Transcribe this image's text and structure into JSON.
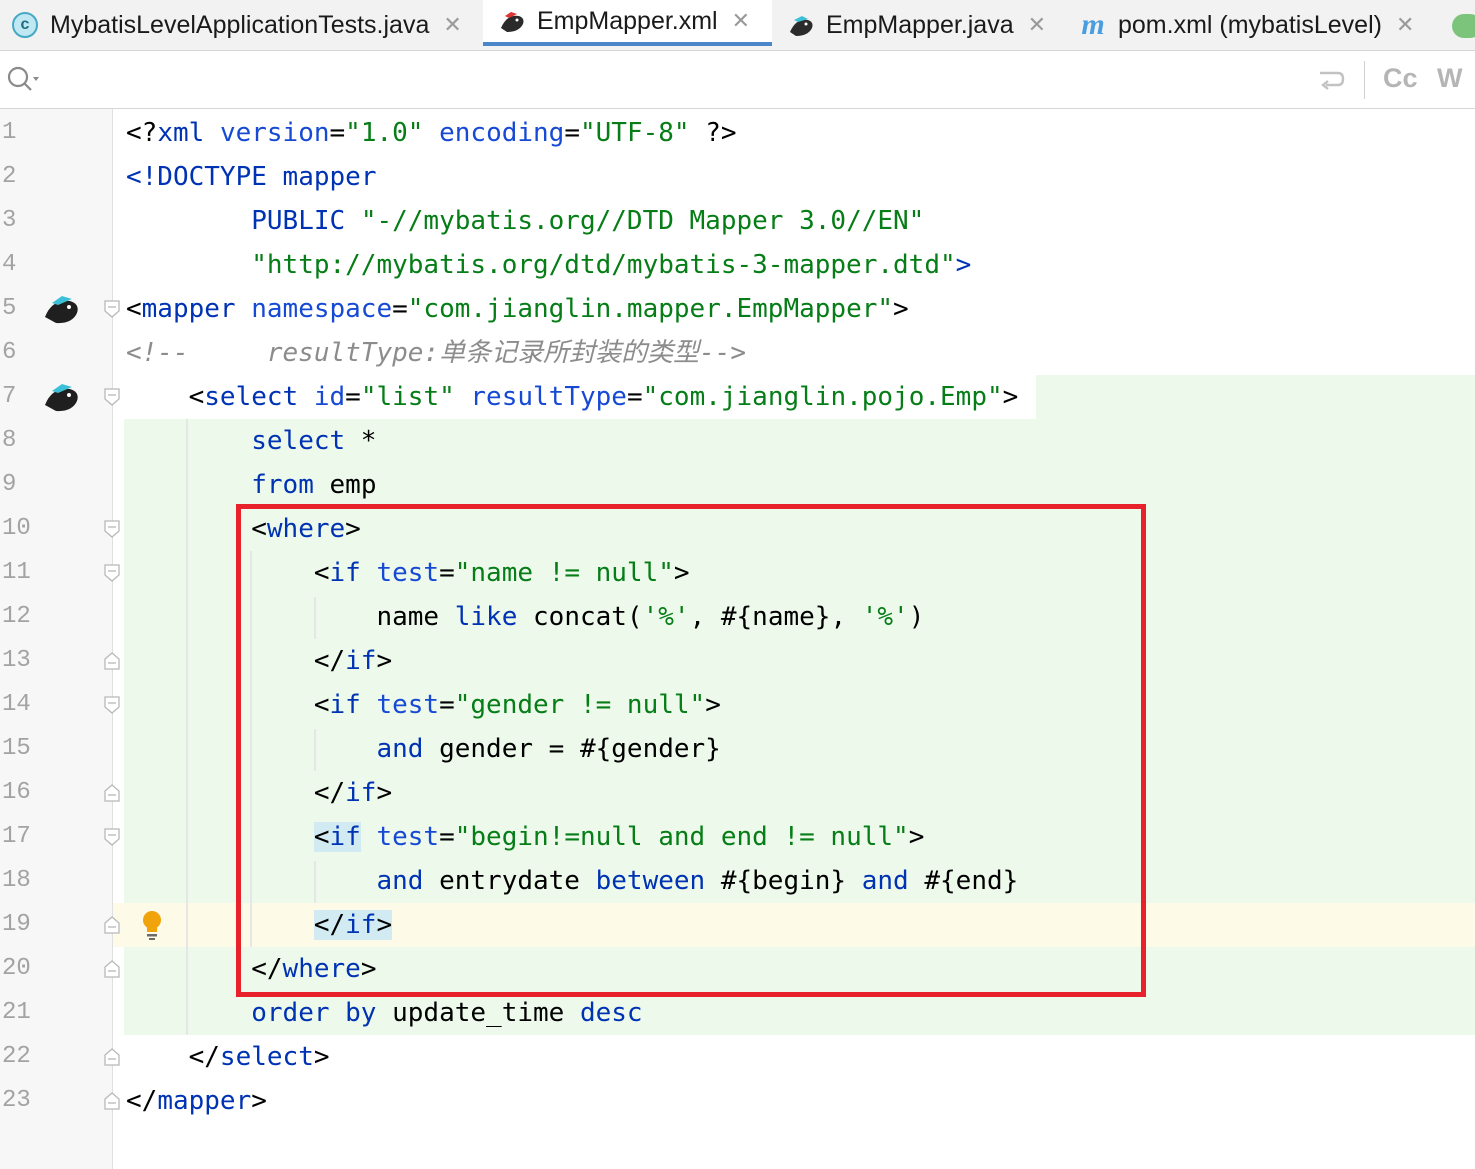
{
  "tabs": [
    {
      "label": "MybatisLevelApplicationTests.java",
      "icon": "java-class-icon",
      "active": false
    },
    {
      "label": "EmpMapper.xml",
      "icon": "mybatis-bird-icon",
      "active": true
    },
    {
      "label": "EmpMapper.java",
      "icon": "mybatis-bird-icon",
      "active": false
    },
    {
      "label": "pom.xml (mybatisLevel)",
      "icon": "maven-icon",
      "active": false
    }
  ],
  "toolbar": {
    "match_case": "Cc",
    "words": "W"
  },
  "colors": {
    "tag": "#0033b3",
    "attribute": "#174ad4",
    "string": "#067d17",
    "comment": "#8c8c8c",
    "highlight_box": "#e8222b",
    "active_tab": "#4a86c8"
  },
  "editor": {
    "line_numbers": [
      "1",
      "2",
      "3",
      "4",
      "5",
      "6",
      "7",
      "8",
      "9",
      "10",
      "11",
      "12",
      "13",
      "14",
      "15",
      "16",
      "17",
      "18",
      "19",
      "20",
      "21",
      "22",
      "23"
    ],
    "lines": [
      {
        "tokens": [
          [
            "p",
            "<?"
          ],
          [
            "t",
            "xml"
          ],
          [
            "p",
            " "
          ],
          [
            "a",
            "version"
          ],
          [
            "p",
            "="
          ],
          [
            "s",
            "\"1.0\""
          ],
          [
            "p",
            " "
          ],
          [
            "a",
            "encoding"
          ],
          [
            "p",
            "="
          ],
          [
            "s",
            "\"UTF-8\""
          ],
          [
            "p",
            " ?>"
          ]
        ]
      },
      {
        "tokens": [
          [
            "t",
            "<!DOCTYPE"
          ],
          [
            "p",
            " "
          ],
          [
            "t",
            "mapper"
          ]
        ]
      },
      {
        "tokens": [
          [
            "p",
            "        "
          ],
          [
            "t",
            "PUBLIC"
          ],
          [
            "p",
            " "
          ],
          [
            "s",
            "\"-//mybatis.org//DTD Mapper 3.0//EN\""
          ]
        ]
      },
      {
        "tokens": [
          [
            "p",
            "        "
          ],
          [
            "s",
            "\"http://mybatis.org/dtd/mybatis-3-mapper.dtd\""
          ],
          [
            "t",
            ">"
          ]
        ]
      },
      {
        "tokens": [
          [
            "p",
            "<"
          ],
          [
            "t",
            "mapper"
          ],
          [
            "p",
            " "
          ],
          [
            "a",
            "namespace"
          ],
          [
            "p",
            "="
          ],
          [
            "s",
            "\"com.jianglin.mapper.EmpMapper\""
          ],
          [
            "p",
            ">"
          ]
        ]
      },
      {
        "tokens": [
          [
            "cm",
            "<!--     resultType:单条记录所封装的类型-->"
          ]
        ]
      },
      {
        "tokens": [
          [
            "p",
            "    <"
          ],
          [
            "t",
            "select"
          ],
          [
            "p",
            " "
          ],
          [
            "a",
            "id"
          ],
          [
            "p",
            "="
          ],
          [
            "s",
            "\"list\""
          ],
          [
            "p",
            " "
          ],
          [
            "a",
            "resultType"
          ],
          [
            "p",
            "="
          ],
          [
            "s",
            "\"com.jianglin.pojo.Emp\""
          ],
          [
            "p",
            ">"
          ]
        ]
      },
      {
        "tokens": [
          [
            "p",
            "        "
          ],
          [
            "t",
            "select"
          ],
          [
            "p",
            " *"
          ]
        ]
      },
      {
        "tokens": [
          [
            "p",
            "        "
          ],
          [
            "t",
            "from"
          ],
          [
            "p",
            " emp"
          ]
        ]
      },
      {
        "tokens": [
          [
            "p",
            "        <"
          ],
          [
            "t",
            "where"
          ],
          [
            "p",
            ">"
          ]
        ]
      },
      {
        "tokens": [
          [
            "p",
            "            <"
          ],
          [
            "t",
            "if"
          ],
          [
            "p",
            " "
          ],
          [
            "a",
            "test"
          ],
          [
            "p",
            "="
          ],
          [
            "s",
            "\"name != null\""
          ],
          [
            "p",
            ">"
          ]
        ]
      },
      {
        "tokens": [
          [
            "p",
            "                name "
          ],
          [
            "t",
            "like"
          ],
          [
            "p",
            " concat("
          ],
          [
            "sq",
            "'%'"
          ],
          [
            "p",
            ", #{name}, "
          ],
          [
            "sq",
            "'%'"
          ],
          [
            "p",
            ")"
          ]
        ]
      },
      {
        "tokens": [
          [
            "p",
            "            </"
          ],
          [
            "t",
            "if"
          ],
          [
            "p",
            ">"
          ]
        ]
      },
      {
        "tokens": [
          [
            "p",
            "            <"
          ],
          [
            "t",
            "if"
          ],
          [
            "p",
            " "
          ],
          [
            "a",
            "test"
          ],
          [
            "p",
            "="
          ],
          [
            "s",
            "\"gender != null\""
          ],
          [
            "p",
            ">"
          ]
        ]
      },
      {
        "tokens": [
          [
            "p",
            "                "
          ],
          [
            "t",
            "and"
          ],
          [
            "p",
            " gender = #{gender}"
          ]
        ]
      },
      {
        "tokens": [
          [
            "p",
            "            </"
          ],
          [
            "t",
            "if"
          ],
          [
            "p",
            ">"
          ]
        ]
      },
      {
        "tokens": [
          [
            "p",
            "            "
          ],
          [
            "tb",
            "<"
          ],
          [
            "tb2",
            "if"
          ],
          [
            "p",
            " "
          ],
          [
            "a",
            "test"
          ],
          [
            "p",
            "="
          ],
          [
            "s",
            "\"begin!=null and end != null\""
          ],
          [
            "p",
            ">"
          ]
        ]
      },
      {
        "tokens": [
          [
            "p",
            "                "
          ],
          [
            "t",
            "and"
          ],
          [
            "p",
            " entrydate "
          ],
          [
            "t",
            "between"
          ],
          [
            "p",
            " #{begin} "
          ],
          [
            "t",
            "and"
          ],
          [
            "p",
            " #{end}"
          ]
        ]
      },
      {
        "tokens": [
          [
            "p",
            "            "
          ],
          [
            "tb",
            "</"
          ],
          [
            "tb2",
            "if"
          ],
          [
            "tb",
            ">"
          ]
        ]
      },
      {
        "tokens": [
          [
            "p",
            "        </"
          ],
          [
            "t",
            "where"
          ],
          [
            "p",
            ">"
          ]
        ]
      },
      {
        "tokens": [
          [
            "p",
            "        "
          ],
          [
            "t",
            "order by"
          ],
          [
            "p",
            " update_time "
          ],
          [
            "t",
            "desc"
          ]
        ]
      },
      {
        "tokens": [
          [
            "p",
            "    </"
          ],
          [
            "t",
            "select"
          ],
          [
            "p",
            ">"
          ]
        ]
      },
      {
        "tokens": [
          [
            "p",
            "</"
          ],
          [
            "t",
            "mapper"
          ],
          [
            "p",
            ">"
          ]
        ]
      }
    ]
  }
}
